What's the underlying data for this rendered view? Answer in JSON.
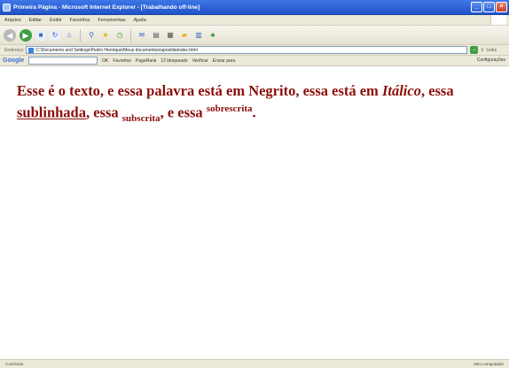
{
  "window": {
    "title": "Primeira Página - Microsoft Internet Explorer - [Trabalhando off-line]",
    "controls": [
      "_",
      "□",
      "×"
    ]
  },
  "menu": [
    "Arquivo",
    "Editar",
    "Exibir",
    "Favoritos",
    "Ferramentas",
    "Ajuda"
  ],
  "toolbar": {
    "icons": [
      "back-icon",
      "forward-icon",
      "stop-icon",
      "refresh-icon",
      "home-icon",
      "search-icon",
      "favorites-icon",
      "history-icon",
      "mail-icon",
      "print-icon",
      "folder-icon",
      "discuss-icon",
      "messenger-icon"
    ]
  },
  "address": {
    "label": "Endereço",
    "value": "C:\\Documents and Settings\\Pedro Henrique\\Meus documentos\\apostila\\index.html",
    "go_label": "Ir",
    "links_label": "Links"
  },
  "googlebar": {
    "logo": "Google",
    "items": [
      "OK",
      "Favoritos",
      "PageRank",
      "12 bloqueado",
      "Verificar",
      "Enviar para"
    ],
    "settings": "Configurações"
  },
  "content": {
    "part1": "Esse é o texto, e essa palavra está em Negrito, essa está em ",
    "italic": "Itálico",
    "part2": ", essa ",
    "underlined": "sublinhada",
    "part3": ", essa ",
    "subscript": "subscrita",
    "part4": ", e essa ",
    "superscript": "sobrescrita",
    "part5": "."
  },
  "status": {
    "text": "Concluído",
    "zone": "Meu computador"
  }
}
